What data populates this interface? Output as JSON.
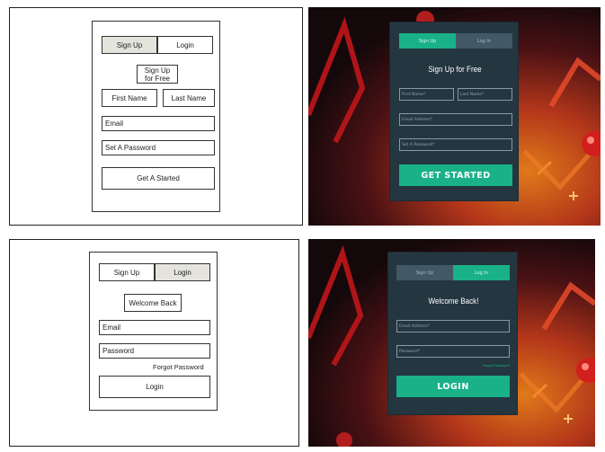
{
  "signup_wireframe": {
    "tab_signup": "Sign Up",
    "tab_login": "Login",
    "title": "Sign Up for Free",
    "first_name": "First Name",
    "last_name": "Last Name",
    "email": "Email",
    "password": "Set A Password",
    "cta": "Get A Started"
  },
  "signup_mockup": {
    "tab_signup": "Sign Up",
    "tab_login": "Log In",
    "title": "Sign Up for Free",
    "first_name": "First Name*",
    "last_name": "Last Name*",
    "email": "Email Address*",
    "password": "Set A Password*",
    "cta": "GET STARTED"
  },
  "login_wireframe": {
    "tab_signup": "Sign Up",
    "tab_login": "Login",
    "title": "Welcome Back",
    "email": "Email",
    "password": "Password",
    "forgot": "Forgot Password",
    "cta": "Login"
  },
  "login_mockup": {
    "tab_signup": "Sign Up",
    "tab_login": "Log In",
    "title": "Welcome Back!",
    "email": "Email Address*",
    "password": "Password*",
    "forgot": "Forgot Password?",
    "cta": "LOGIN"
  },
  "colors": {
    "accent": "#1ab188",
    "form_bg": "#243640",
    "inactive_tab": "#435866",
    "wireframe_shade": "#e4e4dc"
  }
}
